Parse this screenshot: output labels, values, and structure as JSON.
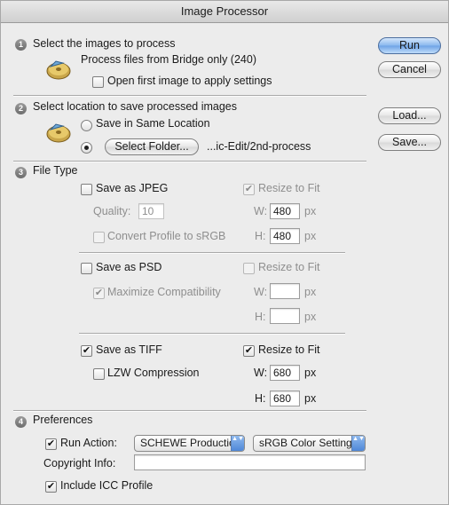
{
  "window": {
    "title": "Image Processor"
  },
  "section1": {
    "number": "1",
    "heading": "Select the images to process",
    "process_from_bridge": "Process files from Bridge only (240)",
    "open_first_label": "Open first image to apply settings",
    "open_first_checked": false
  },
  "section2": {
    "number": "2",
    "heading": "Select location to save processed images",
    "same_location_label": "Save in Same Location",
    "select_folder_label": "Select Folder...",
    "folder_path": "...ic-Edit/2nd-process"
  },
  "section3": {
    "number": "3",
    "heading": "File Type",
    "jpeg": {
      "save_label": "Save as JPEG",
      "resize_label": "Resize to Fit",
      "quality_label": "Quality:",
      "quality_value": "10",
      "convert_label": "Convert Profile to sRGB",
      "w_label": "W:",
      "w_value": "480",
      "h_label": "H:",
      "h_value": "480",
      "unit": "px"
    },
    "psd": {
      "save_label": "Save as PSD",
      "resize_label": "Resize to Fit",
      "max_compat_label": "Maximize Compatibility",
      "w_label": "W:",
      "w_value": "",
      "h_label": "H:",
      "h_value": "",
      "unit": "px"
    },
    "tiff": {
      "save_label": "Save as TIFF",
      "resize_label": "Resize to Fit",
      "lzw_label": "LZW Compression",
      "w_label": "W:",
      "w_value": "680",
      "h_label": "H:",
      "h_value": "680",
      "unit": "px"
    }
  },
  "section4": {
    "number": "4",
    "heading": "Preferences",
    "run_action_label": "Run Action:",
    "action_set": "SCHEWE Productio",
    "action_name": "sRGB Color Setting",
    "copyright_label": "Copyright Info:",
    "copyright_value": "",
    "icc_label": "Include ICC Profile"
  },
  "buttons": {
    "run": "Run",
    "cancel": "Cancel",
    "load": "Load...",
    "save": "Save..."
  },
  "glyphs": {
    "check": "✔",
    "arrows": "▲▼"
  }
}
